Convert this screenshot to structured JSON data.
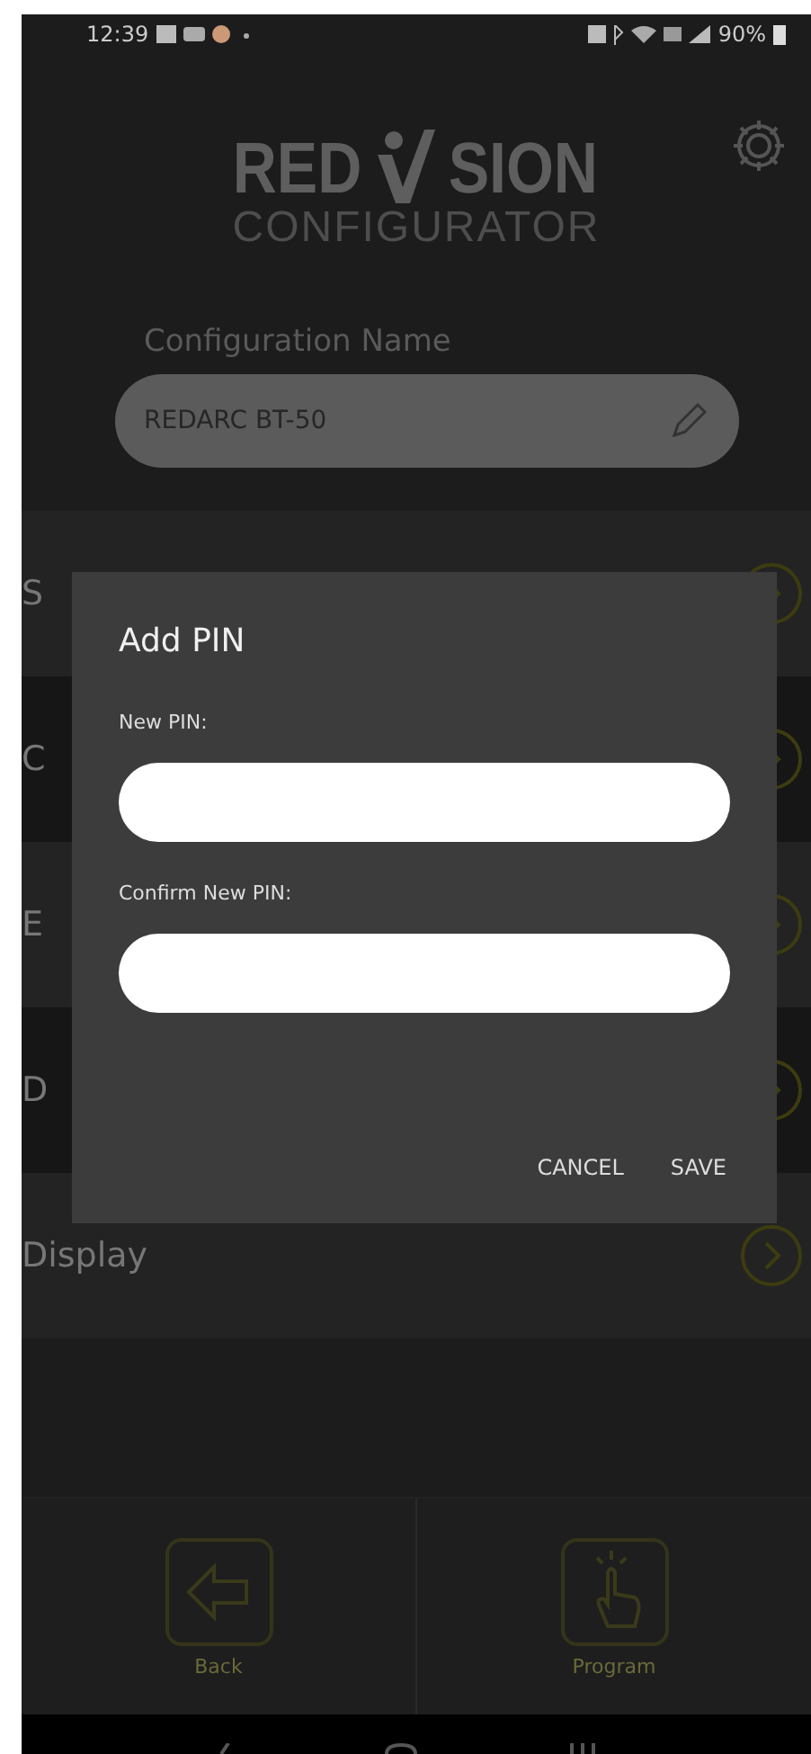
{
  "status_bar": {
    "time": "12:39",
    "battery": "90%"
  },
  "logo": {
    "prefix": "RED",
    "suffix": "SION",
    "subtitle": "CONFIGURATOR"
  },
  "config": {
    "label": "Configuration Name",
    "value": "REDARC BT-50"
  },
  "menu_items": [
    {
      "label": "S"
    },
    {
      "label": "C"
    },
    {
      "label": "E"
    },
    {
      "label": "D"
    },
    {
      "label": "Display"
    }
  ],
  "dialog": {
    "title": "Add PIN",
    "fields": [
      {
        "label": "New PIN:"
      },
      {
        "label": "Confirm New PIN:"
      }
    ],
    "buttons": [
      "CANCEL",
      "SAVE"
    ]
  },
  "bottom_bar": [
    {
      "kind": "back",
      "label": "Back"
    },
    {
      "kind": "program",
      "label": "Program"
    }
  ]
}
